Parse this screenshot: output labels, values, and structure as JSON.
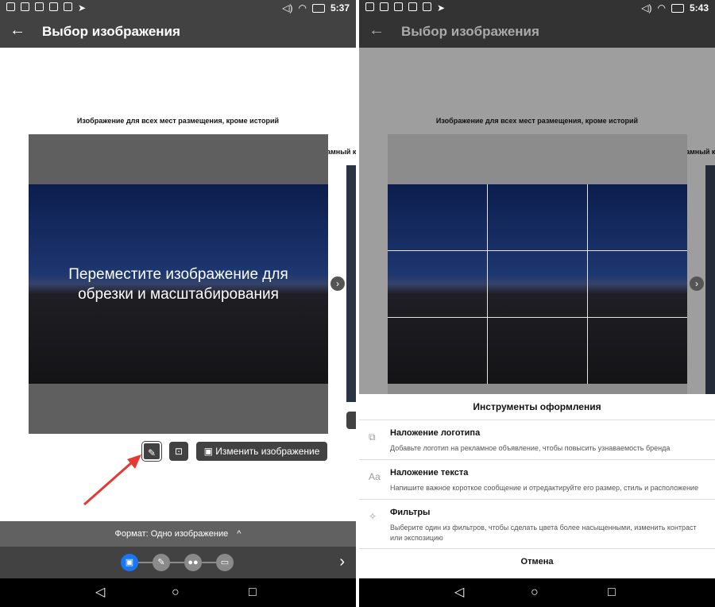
{
  "left": {
    "status": {
      "time": "5:37",
      "battery": "100"
    },
    "appbar": {
      "back": "←",
      "title": "Выбор изображения"
    },
    "caption": "Изображение для всех мест размещения, кроме историй",
    "side_caption": "Рекламный к",
    "overlay_text_line1": "Переместите изображение для",
    "overlay_text_line2": "обрезки и масштабирования",
    "next_arrow": "›",
    "change_image_label": "Изменить изображение",
    "format_label": "Формат: Одно изображение",
    "format_chevron": "^",
    "nav": {
      "back": "◁",
      "home": "○",
      "recent": "□"
    },
    "step_next": "›"
  },
  "right": {
    "status": {
      "time": "5:43",
      "battery": "100"
    },
    "appbar": {
      "back": "←",
      "title": "Выбор изображения"
    },
    "caption": "Изображение для всех мест размещения, кроме историй",
    "side_caption": "Рекламный к",
    "next_arrow": "›",
    "sheet": {
      "title": "Инструменты оформления",
      "tools": [
        {
          "icon": "logo-overlay-icon",
          "title": "Наложение логотипа",
          "desc": "Добавьте логотип на рекламное объявление, чтобы повысить узнаваемость бренда"
        },
        {
          "icon": "text-overlay-icon",
          "title": "Наложение текста",
          "desc": "Напишите важное короткое сообщение и отредактируйте его размер, стиль и расположение"
        },
        {
          "icon": "filters-icon",
          "title": "Фильтры",
          "desc": "Выберите один из фильтров, чтобы сделать цвета более насыщенными, изменить контраст или экспозицию"
        }
      ],
      "cancel": "Отмена"
    },
    "nav": {
      "back": "◁",
      "home": "○",
      "recent": "□"
    }
  },
  "colors": {
    "accent": "#1877f2",
    "annotation": "#e53935",
    "appbar": "#424242"
  }
}
